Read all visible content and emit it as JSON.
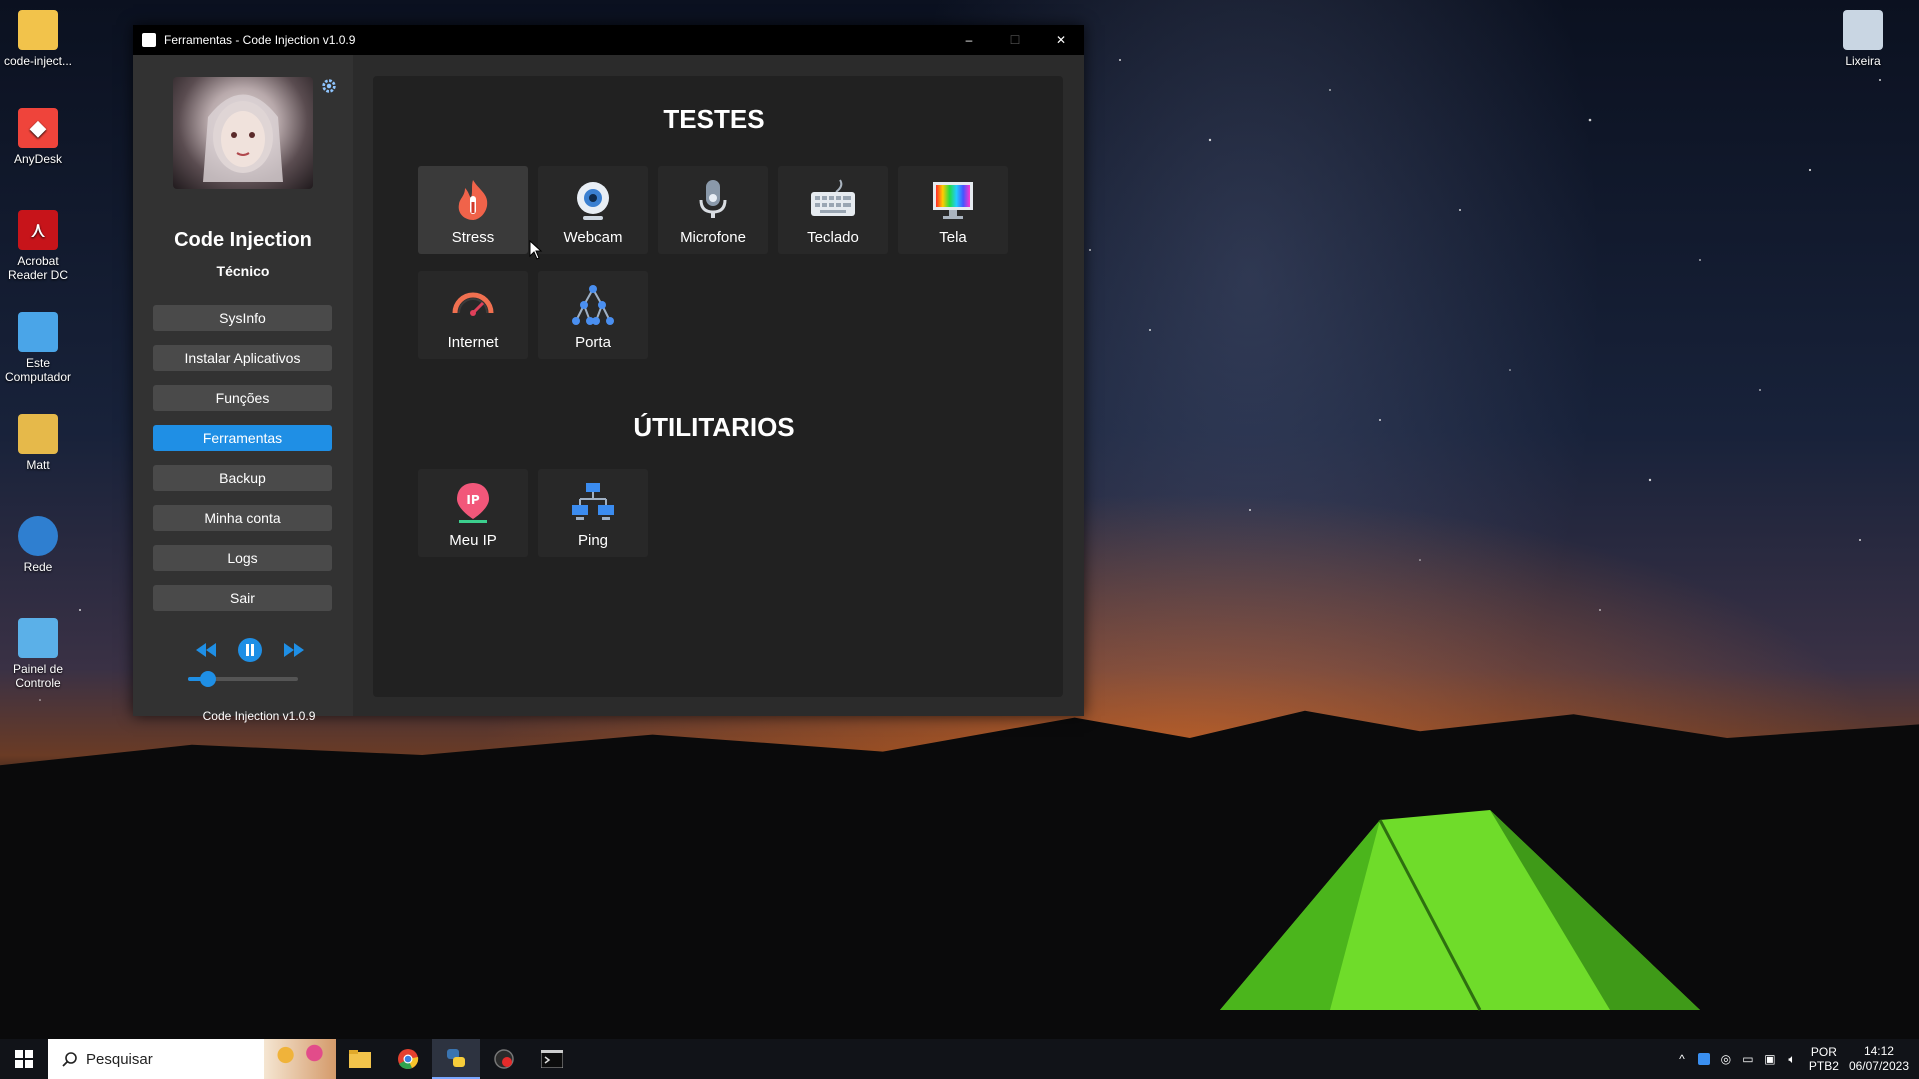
{
  "desktop": {
    "icons": [
      {
        "label": "code-inject..."
      },
      {
        "label": "AnyDesk"
      },
      {
        "label": "Acrobat Reader DC"
      },
      {
        "label": "Este Computador"
      },
      {
        "label": "Matt"
      },
      {
        "label": "Rede"
      },
      {
        "label": "Painel de Controle"
      },
      {
        "label": "Lixeira"
      }
    ]
  },
  "window": {
    "title": "Ferramentas - Code Injection v1.0.9",
    "controls": {
      "minimize": "–",
      "maximize": "☐",
      "close": "✕"
    }
  },
  "sidebar": {
    "user_name": "Code Injection",
    "user_role": "Técnico",
    "nav": [
      {
        "label": "SysInfo",
        "active": false
      },
      {
        "label": "Instalar Aplicativos",
        "active": false
      },
      {
        "label": "Funções",
        "active": false
      },
      {
        "label": "Ferramentas",
        "active": true
      },
      {
        "label": "Backup",
        "active": false
      },
      {
        "label": "Minha conta",
        "active": false
      },
      {
        "label": "Logs",
        "active": false
      },
      {
        "label": "Sair",
        "active": false
      }
    ],
    "player": {
      "volume_percent": 18
    },
    "version": "Code Injection v1.0.9"
  },
  "content": {
    "tests_title": "TESTES",
    "tests": [
      {
        "label": "Stress",
        "icon": "fire-icon"
      },
      {
        "label": "Webcam",
        "icon": "webcam-icon"
      },
      {
        "label": "Microfone",
        "icon": "microphone-icon"
      },
      {
        "label": "Teclado",
        "icon": "keyboard-icon"
      },
      {
        "label": "Tela",
        "icon": "monitor-icon"
      },
      {
        "label": "Internet",
        "icon": "speedometer-icon"
      },
      {
        "label": "Porta",
        "icon": "network-tree-icon"
      }
    ],
    "utilities_title": "ÚTILITARIOS",
    "utilities": [
      {
        "label": "Meu IP",
        "icon": "ip-pin-icon"
      },
      {
        "label": "Ping",
        "icon": "ping-network-icon"
      }
    ]
  },
  "taskbar": {
    "search_placeholder": "Pesquisar",
    "lang": {
      "line1": "POR",
      "line2": "PTB2"
    },
    "time": "14:12",
    "date": "06/07/2023"
  }
}
